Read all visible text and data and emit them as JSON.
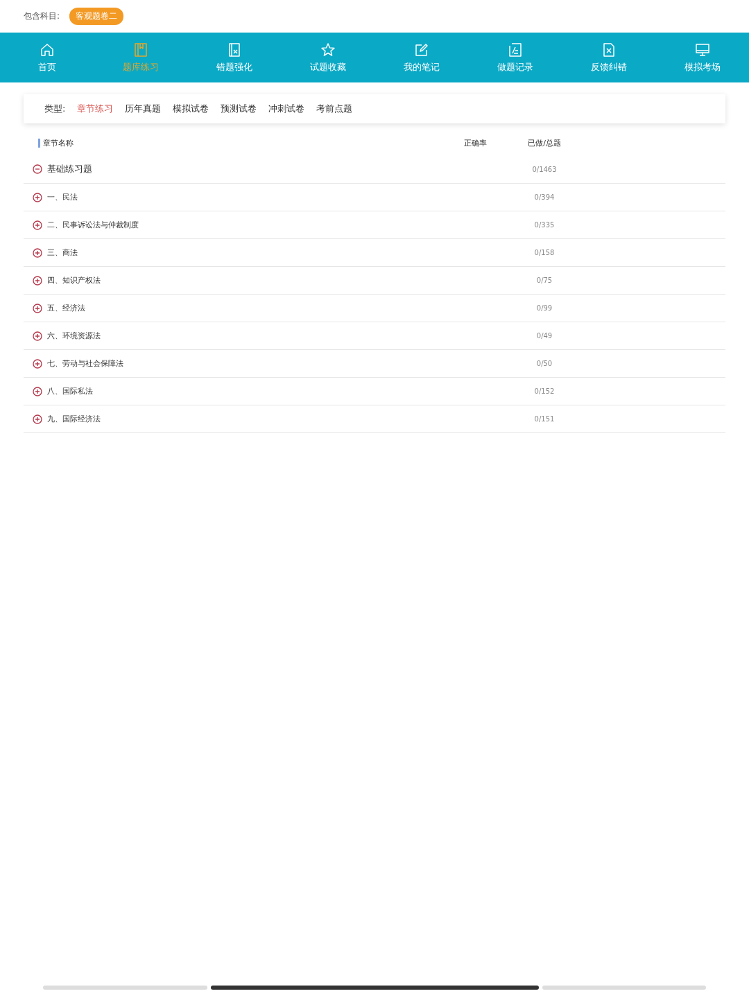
{
  "subjects": {
    "label": "包含科目:",
    "tags": [
      "客观题卷二"
    ]
  },
  "nav": [
    {
      "label": "首页",
      "selected": false
    },
    {
      "label": "题库练习",
      "selected": true
    },
    {
      "label": "错题强化",
      "selected": false
    },
    {
      "label": "试题收藏",
      "selected": false
    },
    {
      "label": "我的笔记",
      "selected": false
    },
    {
      "label": "做题记录",
      "selected": false
    },
    {
      "label": "反馈纠错",
      "selected": false
    },
    {
      "label": "模拟考场",
      "selected": false
    }
  ],
  "filter": {
    "label": "类型:",
    "options": [
      {
        "label": "章节练习",
        "selected": true
      },
      {
        "label": "历年真题",
        "selected": false
      },
      {
        "label": "模拟试卷",
        "selected": false
      },
      {
        "label": "预测试卷",
        "selected": false
      },
      {
        "label": "冲刺试卷",
        "selected": false
      },
      {
        "label": "考前点题",
        "selected": false
      }
    ]
  },
  "table": {
    "columns": [
      "章节名称",
      "正确率",
      "已做/总题"
    ],
    "rows": [
      {
        "name": "基础练习题",
        "progress": "0/1463",
        "expanded": true,
        "children": [
          {
            "name": "一、民法",
            "progress": "0/394",
            "expanded": false
          },
          {
            "name": "二、民事诉讼法与仲裁制度",
            "progress": "0/335",
            "expanded": false
          },
          {
            "name": "三、商法",
            "progress": "0/158",
            "expanded": false
          },
          {
            "name": "四、知识产权法",
            "progress": "0/75",
            "expanded": false
          },
          {
            "name": "五、经济法",
            "progress": "0/99",
            "expanded": false
          },
          {
            "name": "六、环境资源法",
            "progress": "0/49",
            "expanded": false
          },
          {
            "name": "七、劳动与社会保障法",
            "progress": "0/50",
            "expanded": false
          },
          {
            "name": "八、国际私法",
            "progress": "0/152",
            "expanded": false
          },
          {
            "name": "九、国际经济法",
            "progress": "0/151",
            "expanded": false
          }
        ]
      }
    ]
  }
}
